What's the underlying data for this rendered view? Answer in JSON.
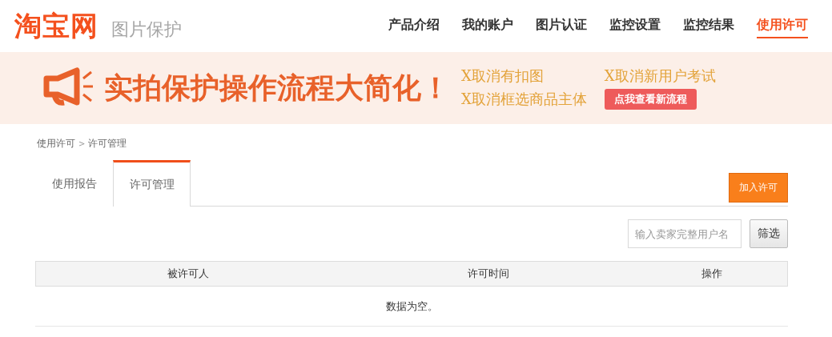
{
  "header": {
    "logo": "淘宝网",
    "subtitle": "图片保护",
    "nav": [
      {
        "label": "产品介绍",
        "selected": false
      },
      {
        "label": "我的账户",
        "selected": false
      },
      {
        "label": "图片认证",
        "selected": false
      },
      {
        "label": "监控设置",
        "selected": false
      },
      {
        "label": "监控结果",
        "selected": false
      },
      {
        "label": "使用许可",
        "selected": true
      }
    ]
  },
  "banner": {
    "headline": "实拍保护操作流程大简化！",
    "points": [
      "X取消有扣图",
      "X取消新用户考试",
      "X取消框选商品主体"
    ],
    "button": "点我查看新流程"
  },
  "breadcrumb": {
    "items": [
      "使用许可",
      "许可管理"
    ],
    "separator": ">"
  },
  "tabs": [
    {
      "label": "使用报告",
      "selected": false
    },
    {
      "label": "许可管理",
      "selected": true
    }
  ],
  "add_button": "加入许可",
  "filter": {
    "placeholder": "输入卖家完整用户名",
    "button": "筛选"
  },
  "table": {
    "columns": [
      "被许可人",
      "许可时间",
      "操作"
    ],
    "empty_text": "数据为空。"
  }
}
